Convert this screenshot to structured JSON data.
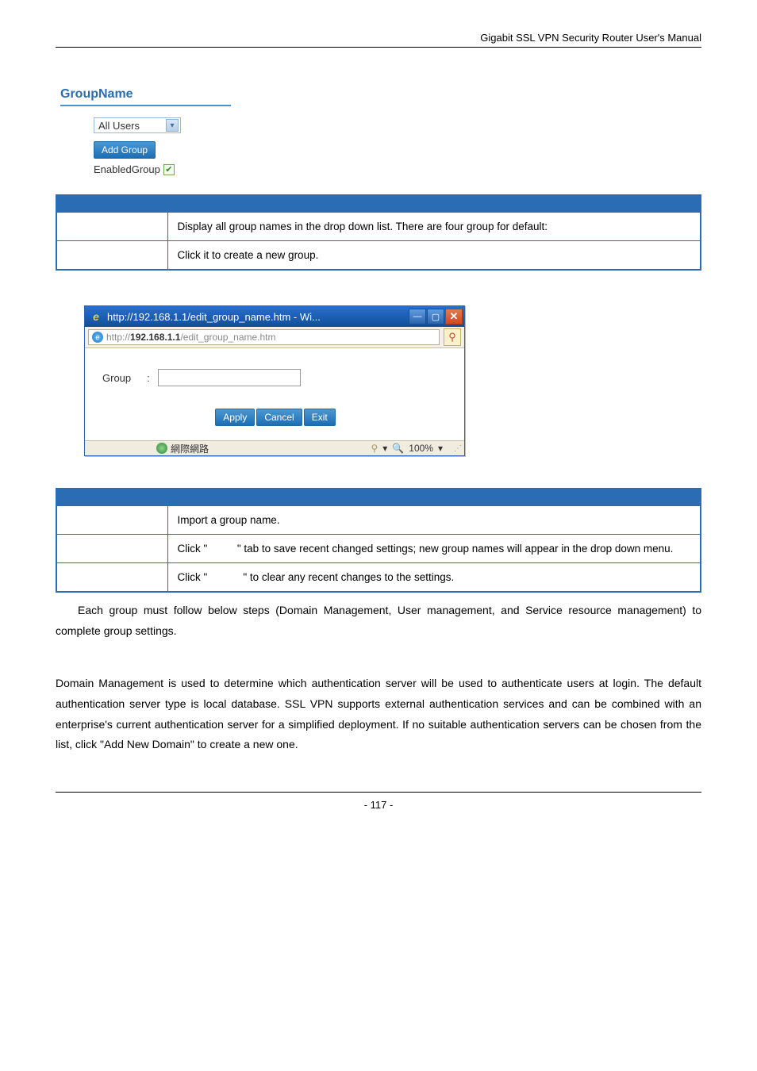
{
  "header": {
    "right": "Gigabit SSL VPN Security Router User's Manual"
  },
  "section": {
    "heading": "GroupName",
    "select_value": "All Users",
    "add_group_btn": "Add Group",
    "enabled_label": "EnabledGroup"
  },
  "table1": {
    "row1": "Display all group names in the drop down list. There are four group for default:",
    "row2": "Click it to create a new group."
  },
  "popup": {
    "title": "http://192.168.1.1/edit_group_name.htm - Wi...",
    "url_prefix": "http://",
    "url_bold": "192.168.1.1",
    "url_rest": "/edit_group_name.htm",
    "group_label": "Group",
    "group_sep": ":",
    "apply_btn": "Apply",
    "cancel_btn": "Cancel",
    "exit_btn": "Exit",
    "status_text": "網際網路",
    "zoom": "100%"
  },
  "table2": {
    "row1": "Import a group name.",
    "row2_a": "Click \"",
    "row2_b": "\" tab to save recent changed settings; new group names will appear in the drop down menu.",
    "row3_a": "Click \"",
    "row3_b": "\" to clear any recent changes to the settings."
  },
  "para1": "Each group must follow below steps (Domain Management, User management, and Service resource management) to complete group settings.",
  "para2": "Domain Management is used to determine which authentication server will be used to authenticate users at login. The default authentication server type is local database. SSL VPN supports external authentication services and can be combined with an enterprise's current authentication server for a simplified deployment. If no suitable authentication servers can be chosen from the list, click \"Add New Domain\" to create a new one.",
  "footer": {
    "page": "- 117 -"
  }
}
